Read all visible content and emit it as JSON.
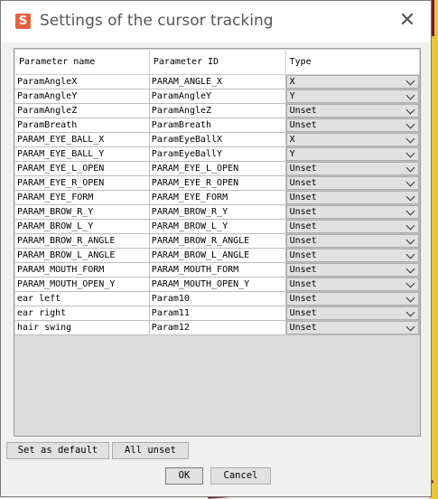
{
  "window": {
    "title": "Settings of the cursor tracking",
    "app_icon_glyph": "S"
  },
  "table": {
    "headers": [
      "Parameter name",
      "Parameter ID",
      "Type"
    ],
    "rows": [
      {
        "name": "ParamAngleX",
        "id": "PARAM_ANGLE_X",
        "type": "X"
      },
      {
        "name": "ParamAngleY",
        "id": "ParamAngleY",
        "type": "Y"
      },
      {
        "name": "ParamAngleZ",
        "id": "ParamAngleZ",
        "type": "Unset"
      },
      {
        "name": "ParamBreath",
        "id": "ParamBreath",
        "type": "Unset"
      },
      {
        "name": "PARAM_EYE_BALL_X",
        "id": "ParamEyeBallX",
        "type": "X"
      },
      {
        "name": "PARAM_EYE_BALL_Y",
        "id": "ParamEyeBallY",
        "type": "Y"
      },
      {
        "name": "PARAM_EYE_L_OPEN",
        "id": "PARAM_EYE_L_OPEN",
        "type": "Unset"
      },
      {
        "name": "PARAM_EYE_R_OPEN",
        "id": "PARAM_EYE_R_OPEN",
        "type": "Unset"
      },
      {
        "name": "PARAM_EYE_FORM",
        "id": "PARAM_EYE_FORM",
        "type": "Unset"
      },
      {
        "name": "PARAM_BROW_R_Y",
        "id": "PARAM_BROW_R_Y",
        "type": "Unset"
      },
      {
        "name": "PARAM_BROW_L_Y",
        "id": "PARAM_BROW_L_Y",
        "type": "Unset"
      },
      {
        "name": "PARAM_BROW_R_ANGLE",
        "id": "PARAM_BROW_R_ANGLE",
        "type": "Unset"
      },
      {
        "name": "PARAM_BROW_L_ANGLE",
        "id": "PARAM_BROW_L_ANGLE",
        "type": "Unset"
      },
      {
        "name": "PARAM_MOUTH_FORM",
        "id": "PARAM_MOUTH_FORM",
        "type": "Unset"
      },
      {
        "name": "PARAM_MOUTH_OPEN_Y",
        "id": "PARAM_MOUTH_OPEN_Y",
        "type": "Unset"
      },
      {
        "name": "ear left",
        "id": "Param10",
        "type": "Unset"
      },
      {
        "name": "ear right",
        "id": "Param11",
        "type": "Unset"
      },
      {
        "name": "hair swing",
        "id": "Param12",
        "type": "Unset"
      }
    ]
  },
  "buttons": {
    "set_default": "Set as default",
    "all_unset": "All unset",
    "ok": "OK",
    "cancel": "Cancel"
  },
  "colors": {
    "app_icon": "#e8603a",
    "background_accent": "#e8c733"
  }
}
